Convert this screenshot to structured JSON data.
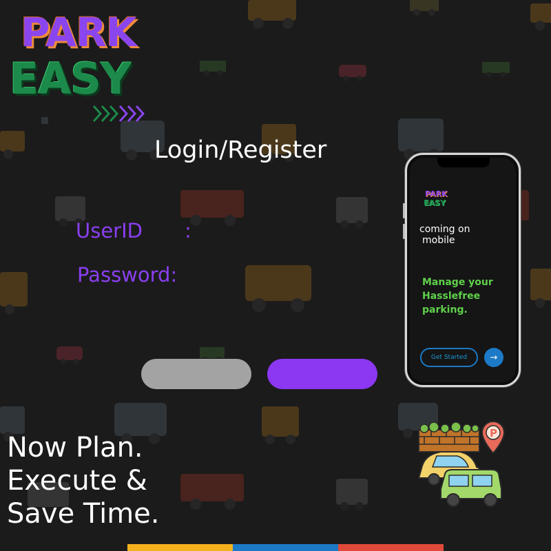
{
  "logo": {
    "line1": "PARK",
    "line2": "EASY",
    "arrows": "chevron-arrows-icon"
  },
  "login": {
    "heading": "Login/Register",
    "userid_label": "UserID",
    "userid_colon": ":",
    "password_label": "Password:",
    "left_button_label": "",
    "right_button_label": ""
  },
  "tagline": {
    "line1": "Now Plan.",
    "line2": "Execute &",
    "line3": "Save Time."
  },
  "phone": {
    "logo_line1": "PARK",
    "logo_line2": "EASY",
    "coming_line1": "coming on",
    "coming_line2": "mobile",
    "manage_line1": "Manage your",
    "manage_line2": "Hasslefree",
    "manage_line3": "parking.",
    "get_started": "Get Started",
    "arrow": "→"
  },
  "colors": {
    "background": "#1b1b1b",
    "purple": "#8c37f2",
    "green": "#1c8a4a",
    "grey_button": "#a3a3a3",
    "bar_yellow": "#f5b11d",
    "bar_blue": "#1c7ac6",
    "bar_red": "#e04a3b"
  },
  "icons": {
    "background": "vehicle-pattern",
    "illustration": "parking-lot-icon"
  }
}
